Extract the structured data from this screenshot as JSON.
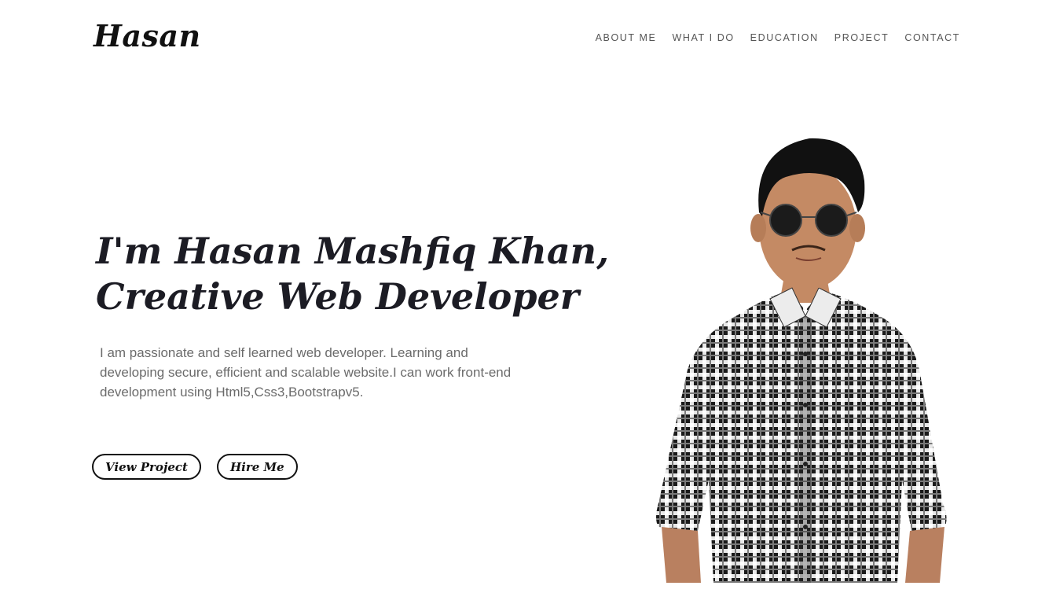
{
  "brand": "Hasan",
  "nav": {
    "items": [
      {
        "label": "ABOUT ME"
      },
      {
        "label": "WHAT I DO"
      },
      {
        "label": "EDUCATION"
      },
      {
        "label": "PROJECT"
      },
      {
        "label": "CONTACT"
      }
    ]
  },
  "hero": {
    "headline_line1": "I'm Hasan Mashfiq Khan,",
    "headline_line2": "Creative Web Developer",
    "intro": "I am passionate and self learned web developer. Learning and developing secure, efficient and scalable website.I can work front-end development using Html5,Css3,Bootstrapv5.",
    "buttons": {
      "view_project": "View Project",
      "hire_me": "Hire Me"
    }
  },
  "colors": {
    "text_dark": "#1c1c24",
    "text_muted": "#6b6b6b",
    "nav_text": "#555555",
    "background": "#ffffff"
  },
  "icons": {
    "portrait": "person-photo"
  }
}
